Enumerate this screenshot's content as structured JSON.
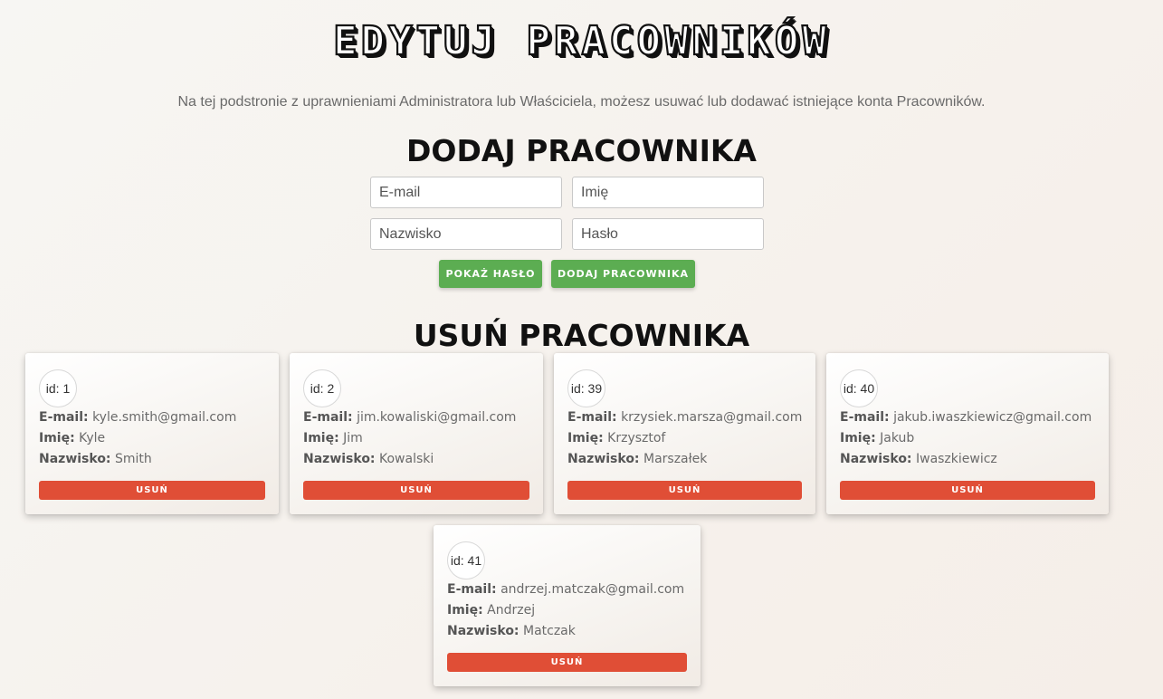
{
  "header": {
    "title": "EDYTUJ PRACOWNIKÓW",
    "subtitle": "Na tej podstronie z uprawnieniami Administratora lub Właściciela, możesz usuwać lub dodawać istniejące konta Pracowników."
  },
  "add_section": {
    "title": "DODAJ PRACOWNIKA",
    "email_placeholder": "E-mail",
    "name_placeholder": "Imię",
    "surname_placeholder": "Nazwisko",
    "password_placeholder": "Hasło",
    "show_password_label": "POKAŻ HASŁO",
    "add_button_label": "DODAJ PRACOWNIKA"
  },
  "remove_section": {
    "title": "USUŃ PRACOWNIKA",
    "email_label": "E-mail:",
    "name_label": "Imię:",
    "surname_label": "Nazwisko:",
    "delete_label": "USUŃ",
    "employees": [
      {
        "id": "id: 1",
        "email": "kyle.smith@gmail.com",
        "name": "Kyle",
        "surname": "Smith"
      },
      {
        "id": "id: 2",
        "email": "jim.kowaliski@gmail.com",
        "name": "Jim",
        "surname": "Kowalski"
      },
      {
        "id": "id: 39",
        "email": "krzysiek.marsza@gmail.com",
        "name": "Krzysztof",
        "surname": "Marszałek"
      },
      {
        "id": "id: 40",
        "email": "jakub.iwaszkiewicz@gmail.com",
        "name": "Jakub",
        "surname": "Iwaszkiewicz"
      },
      {
        "id": "id: 41",
        "email": "andrzej.matczak@gmail.com",
        "name": "Andrzej",
        "surname": "Matczak"
      }
    ]
  },
  "colors": {
    "green_button": "#5cad52",
    "red_button": "#e04e36"
  }
}
